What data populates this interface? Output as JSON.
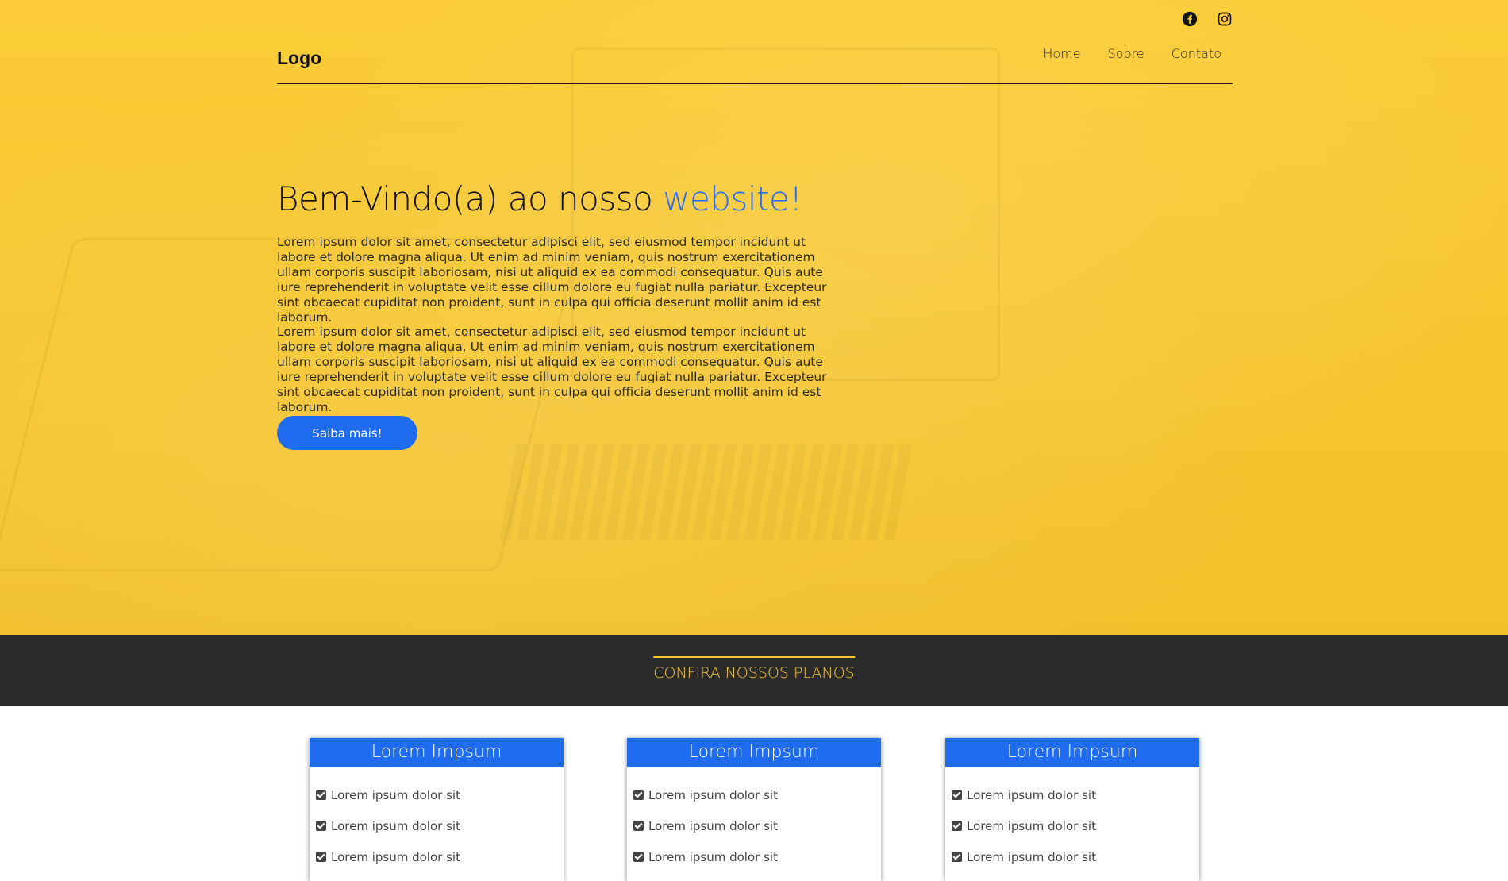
{
  "header": {
    "logo": "Logo",
    "nav": [
      {
        "label": "Home"
      },
      {
        "label": "Sobre"
      },
      {
        "label": "Contato"
      }
    ],
    "social": [
      "facebook-icon",
      "instagram-icon"
    ]
  },
  "hero": {
    "title_main": "Bem-Vindo(a) ao nosso ",
    "title_accent": "website!",
    "paragraph1": "Lorem ipsum dolor sit amet, consectetur adipisci elit, sed eiusmod tempor incidunt ut labore et dolore magna aliqua. Ut enim ad minim veniam, quis nostrum exercitationem ullam corporis suscipit laboriosam, nisi ut aliquid ex ea commodi consequatur. Quis aute iure reprehenderit in voluptate velit esse cillum dolore eu fugiat nulla pariatur. Excepteur sint obcaecat cupiditat non proident, sunt in culpa qui officia deserunt mollit anim id est laborum.",
    "paragraph2": "Lorem ipsum dolor sit amet, consectetur adipisci elit, sed eiusmod tempor incidunt ut labore et dolore magna aliqua. Ut enim ad minim veniam, quis nostrum exercitationem ullam corporis suscipit laboriosam, nisi ut aliquid ex ea commodi consequatur. Quis aute iure reprehenderit in voluptate velit esse cillum dolore eu fugiat nulla pariatur. Excepteur sint obcaecat cupiditat non proident, sunt in culpa qui officia deserunt mollit anim id est laborum.",
    "button": "Saiba mais!"
  },
  "plans": {
    "title": "CONFIRA NOSSOS PLANOS",
    "cards": [
      {
        "title": "Lorem Impsum",
        "items": [
          "Lorem ipsum dolor sit",
          "Lorem ipsum dolor sit",
          "Lorem ipsum dolor sit"
        ]
      },
      {
        "title": "Lorem Impsum",
        "items": [
          "Lorem ipsum dolor sit",
          "Lorem ipsum dolor sit",
          "Lorem ipsum dolor sit"
        ]
      },
      {
        "title": "Lorem Impsum",
        "items": [
          "Lorem ipsum dolor sit",
          "Lorem ipsum dolor sit",
          "Lorem ipsum dolor sit"
        ]
      }
    ]
  },
  "colors": {
    "hero_bg": "#f5c430",
    "accent_blue": "#1f6cf0",
    "dark_bar": "#2b2b2b",
    "plans_title": "#f5c430"
  }
}
